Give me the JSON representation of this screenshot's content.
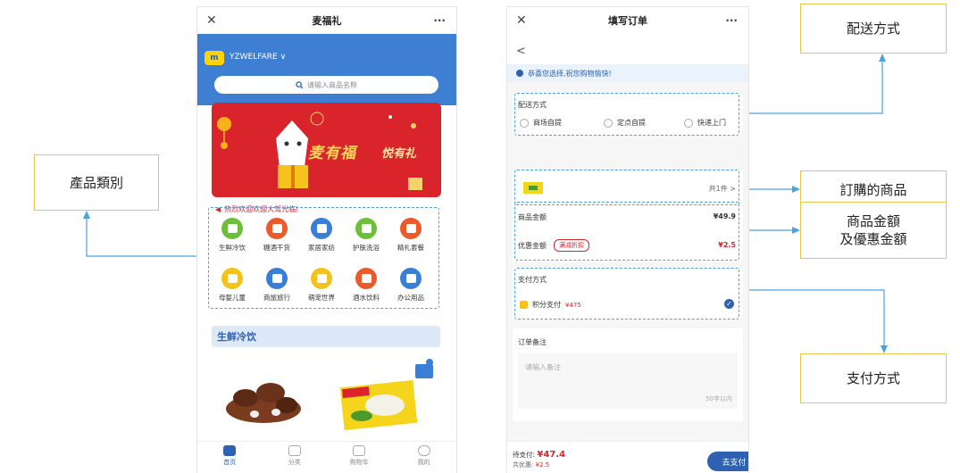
{
  "callouts": {
    "product_category": "產品類別",
    "delivery_method": "配送方式",
    "ordered_items": "訂購的商品",
    "amount_line1": "商品金額",
    "amount_line2": "及優惠金額",
    "payment_method": "支付方式"
  },
  "left_phone": {
    "title": "麦福礼",
    "close_glyph": "✕",
    "more_glyph": "···",
    "brand": "YZWELFARE",
    "brand_chevron": "∨",
    "search_placeholder": "请输入商品名称",
    "banner_text_1": "麦有福",
    "banner_text_2": "悦有礼",
    "notice": "热烈欢迎欢迎大驾光临!",
    "categories": [
      {
        "label": "生鲜冷饮",
        "color": "#6cbf3a"
      },
      {
        "label": "糖酒干货",
        "color": "#ea5a2a"
      },
      {
        "label": "家居家纺",
        "color": "#3a7fd6"
      },
      {
        "label": "护肤洗浴",
        "color": "#6cbf3a"
      },
      {
        "label": "精礼套餐",
        "color": "#ea5a2a"
      },
      {
        "label": "母婴儿童",
        "color": "#f5c21b"
      },
      {
        "label": "商旅旅行",
        "color": "#3a7fd6"
      },
      {
        "label": "萌宠世界",
        "color": "#f5c21b"
      },
      {
        "label": "酒水饮料",
        "color": "#ea5a2a"
      },
      {
        "label": "办公用品",
        "color": "#3a7fd6"
      }
    ],
    "section_title": "生鲜冷饮",
    "tabs": [
      "首页",
      "分类",
      "购物车",
      "我的"
    ]
  },
  "right_phone": {
    "title": "填写订单",
    "close_glyph": "✕",
    "more_glyph": "···",
    "back_glyph": "<",
    "notice": "恭喜您选择,祝您购物愉快!",
    "delivery_label": "配送方式",
    "delivery_options": [
      "商场自提",
      "定点自提",
      "快递上门"
    ],
    "items_count": "共1件 >",
    "goods_amount_label": "商品金额",
    "goods_amount_value": "¥49.9",
    "discount_label": "优惠金额",
    "discount_badge": "满减折扣",
    "discount_value": "¥2.5",
    "payment_label": "支付方式",
    "payment_option": "积分支付",
    "payment_points": "¥475",
    "remark_label": "订单备注",
    "remark_placeholder": "请输入备注",
    "remark_counter": "50字以内",
    "to_pay_label": "待支付:",
    "to_pay_value": "¥47.4",
    "saved_label": "共优惠:",
    "saved_value": "¥2.5",
    "pay_button": "去支付"
  },
  "colors": {
    "accent_blue": "#2e61b1",
    "header_blue": "#3e7fd4",
    "banner_red": "#d9242b",
    "callout_border": "#e6c84a",
    "leader_line": "#4aa3df"
  }
}
